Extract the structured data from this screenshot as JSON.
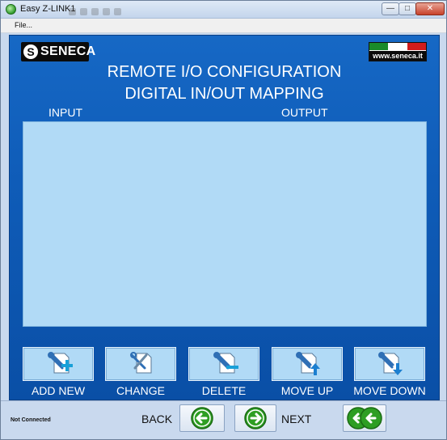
{
  "window": {
    "title": "Easy Z-LINK1"
  },
  "menu": {
    "file": "File..."
  },
  "brand": {
    "logo_letter": "S",
    "logo_text": "SENECA",
    "url": "www.seneca.it"
  },
  "header": {
    "title_line1": "REMOTE I/O CONFIGURATION",
    "title_line2": "DIGITAL IN/OUT MAPPING"
  },
  "columns": {
    "input": "INPUT",
    "output": "OUTPUT"
  },
  "actions": [
    {
      "label": "ADD NEW"
    },
    {
      "label": "CHANGE"
    },
    {
      "label": "DELETE"
    },
    {
      "label": "MOVE UP"
    },
    {
      "label": "MOVE DOWN"
    }
  ],
  "footer": {
    "status": "Not Connected",
    "back_label": "BACK",
    "next_label": "NEXT"
  },
  "colors": {
    "panel": "#1668c5",
    "list_background": "#b1daf6",
    "nav_arrow": "#2e9e23"
  }
}
